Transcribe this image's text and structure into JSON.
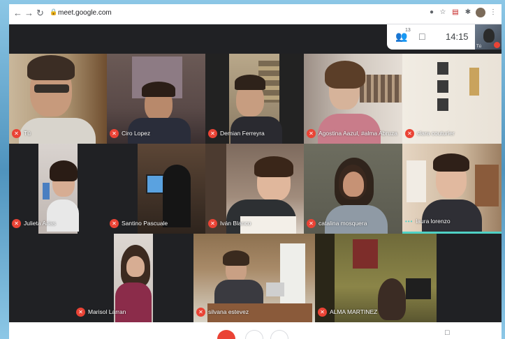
{
  "browser": {
    "url": "meet.google.com",
    "back_icon": "arrow-left-icon",
    "forward_icon": "arrow-right-icon",
    "reload_icon": "reload-icon",
    "lock_icon": "lock-icon"
  },
  "meet": {
    "participants_count": "13",
    "time": "14:15",
    "self_label": "Tú"
  },
  "participants": [
    {
      "name": "Tú"
    },
    {
      "name": "Ciro Lopez"
    },
    {
      "name": "Demian Ferreyra"
    },
    {
      "name": "Agostina Aazul, #alma Abruza"
    },
    {
      "name": "clara couturier"
    },
    {
      "name": "Julieta Arias"
    },
    {
      "name": "Santino Pascuale"
    },
    {
      "name": "Iván Blanco"
    },
    {
      "name": "catalina mosquera"
    },
    {
      "name": "laura lorenzo"
    },
    {
      "name": "Marisol Larran"
    },
    {
      "name": "silvana estevez"
    },
    {
      "name": "ALMA MARTINEZ"
    }
  ],
  "colors": {
    "mic_muted": "#ea4335",
    "speaking_indicator": "#4fd1c5",
    "meet_background": "#202124"
  }
}
